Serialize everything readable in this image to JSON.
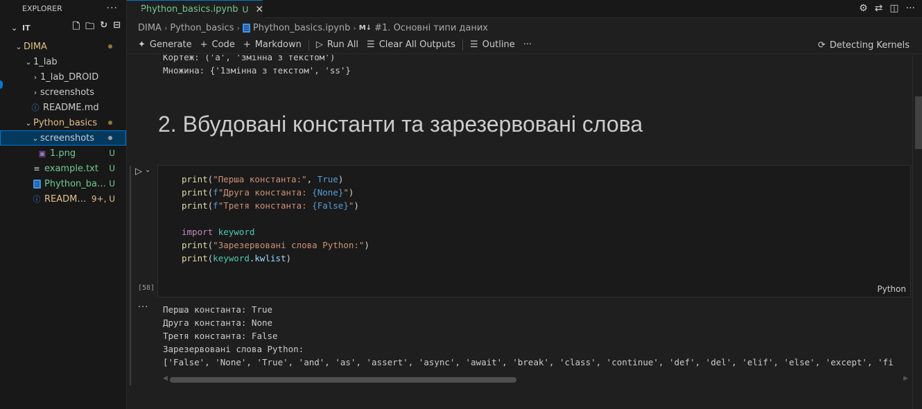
{
  "explorer": {
    "title": "EXPLORER",
    "more": "···",
    "root_label": "IT",
    "items": [
      {
        "label": "DIMA",
        "badge": ""
      },
      {
        "label": "1_lab",
        "badge": ""
      },
      {
        "label": "1_lab_DROID",
        "badge": ""
      },
      {
        "label": "screenshots",
        "badge": ""
      },
      {
        "label": "README.md",
        "badge": ""
      },
      {
        "label": "Python_basics",
        "badge": ""
      },
      {
        "label": "screenshots",
        "badge": ""
      },
      {
        "label": "1.png",
        "badge": "U"
      },
      {
        "label": "example.txt",
        "badge": "U"
      },
      {
        "label": "Phython_basi...",
        "badge": "U"
      },
      {
        "label": "README....",
        "badge": "9+, U"
      }
    ]
  },
  "tab": {
    "label": "Phython_basics.ipynb",
    "status": "U",
    "close": "✕"
  },
  "breadcrumb": {
    "items": [
      "DIMA",
      "Python_basics",
      "Phython_basics.ipynb",
      "#1. Основні типи даних"
    ],
    "md_prefix": "M↓"
  },
  "toolbar": {
    "generate": "Generate",
    "code": "Code",
    "markdown": "Markdown",
    "run_all": "Run All",
    "clear_all": "Clear All Outputs",
    "outline": "Outline",
    "more": "···",
    "kernel": "Detecting Kernels"
  },
  "notebook": {
    "prev_output": [
      "Кортеж: ('a', 'змінна з текстом')",
      "Множина: {'1змінна з текстом', 'ss'}"
    ],
    "heading": "2. Вбудовані константи та зарезервовані слова",
    "cell": {
      "exec_count": "[58]",
      "language": "Python",
      "code_lines": [
        "print(\"Перша константа:\", True)",
        "print(f\"Друга константа: {None}\")",
        "print(f\"Третя константа: {False}\")",
        "",
        "import keyword",
        "print(\"Зарезервовані слова Python:\")",
        "print(keyword.kwlist)"
      ]
    },
    "output_more": "···",
    "output_lines": [
      "Перша константа: True",
      "Друга константа: None",
      "Третя константа: False",
      "Зарезервовані слова Python:",
      "['False', 'None', 'True', 'and', 'as', 'assert', 'async', 'await', 'break', 'class', 'continue', 'def', 'del', 'elif', 'else', 'except', 'fi"
    ]
  }
}
